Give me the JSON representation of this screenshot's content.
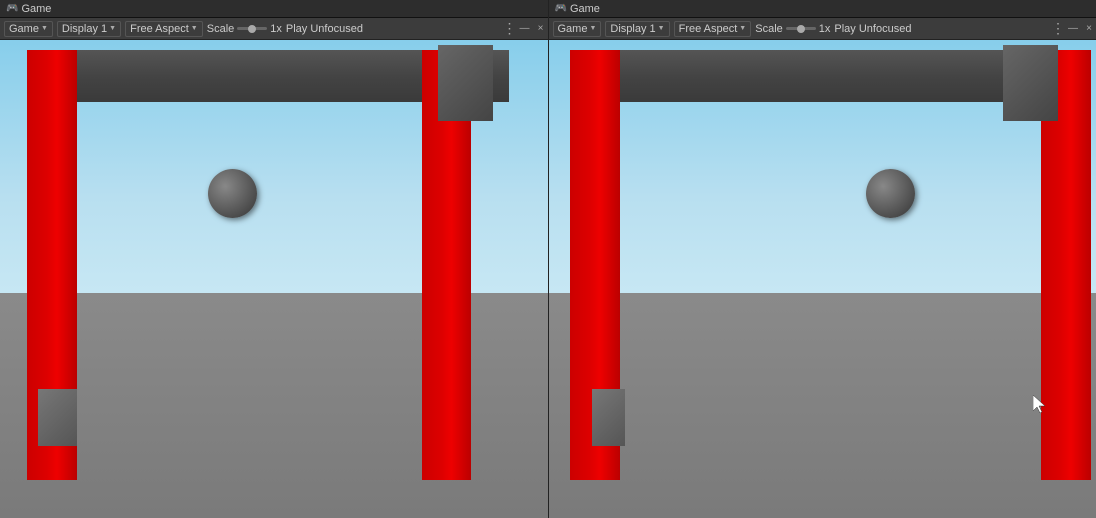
{
  "panel1": {
    "tab_icon": "🎮",
    "tab_label": "Game",
    "game_label": "Game",
    "display_label": "Display 1",
    "aspect_label": "Free Aspect",
    "scale_label": "Scale",
    "scale_value": "1x",
    "play_label": "Play Unfocused",
    "dots": "⋮",
    "minimize": "—",
    "close": "×"
  },
  "panel2": {
    "tab_icon": "🎮",
    "tab_label": "Game",
    "game_label": "Game",
    "display_label": "Display 1",
    "aspect_label": "Free Aspect",
    "scale_label": "Scale",
    "scale_value": "1x",
    "play_label": "Play Unfocused",
    "dots": "⋮",
    "minimize": "—",
    "close": "×"
  }
}
